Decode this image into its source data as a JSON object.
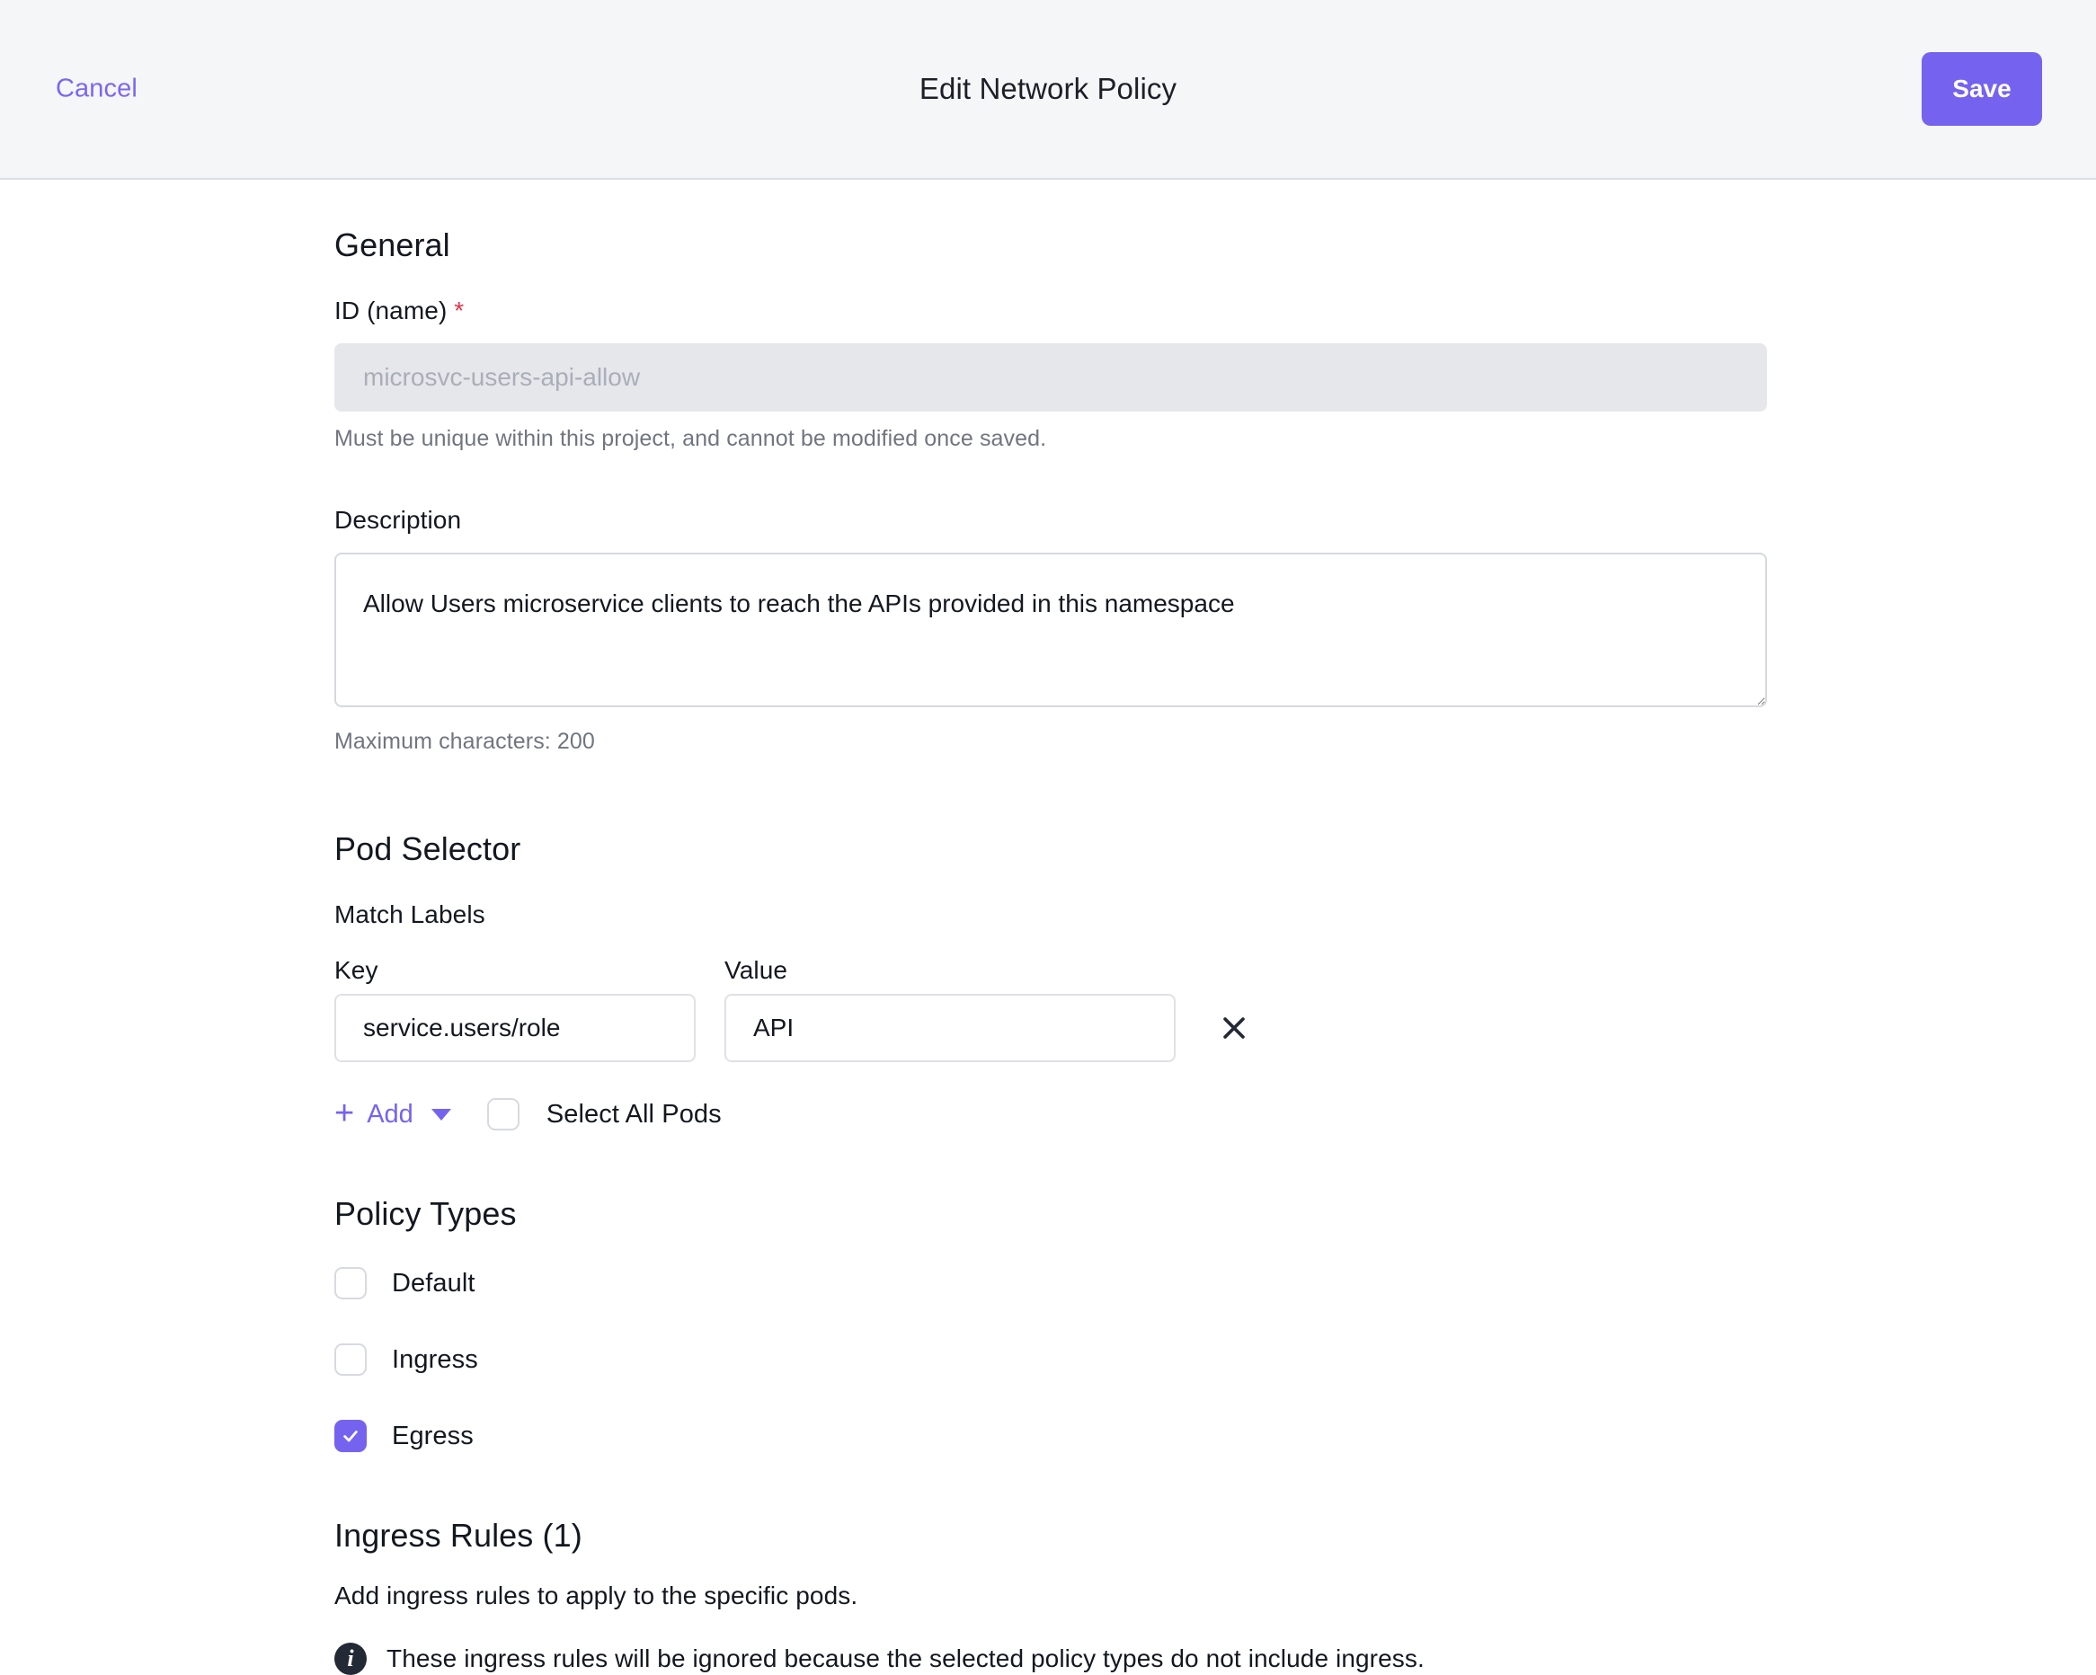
{
  "header": {
    "cancel_label": "Cancel",
    "title": "Edit Network Policy",
    "save_label": "Save",
    "accent_color": "#7563F0",
    "background_color": "#F5F6F8"
  },
  "general": {
    "section_title": "General",
    "id_label": "ID (name)",
    "id_required_mark": "*",
    "id_value": "microsvc-users-api-allow",
    "id_help": "Must be unique within this project, and cannot be modified once saved.",
    "description_label": "Description",
    "description_value": "Allow Users microservice clients to reach the APIs provided in this namespace",
    "description_help": "Maximum characters: 200"
  },
  "pod_selector": {
    "section_title": "Pod Selector",
    "match_labels_label": "Match Labels",
    "key_header": "Key",
    "value_header": "Value",
    "rows": [
      {
        "key": "service.users/role",
        "value": "API",
        "remove_icon": "close-icon"
      }
    ],
    "add_label": "Add",
    "add_icon": "plus-icon",
    "add_caret_icon": "chevron-down-icon",
    "select_all_label": "Select All Pods",
    "select_all_checked": false
  },
  "policy_types": {
    "section_title": "Policy Types",
    "options": [
      {
        "label": "Default",
        "checked": false
      },
      {
        "label": "Ingress",
        "checked": false
      },
      {
        "label": "Egress",
        "checked": true
      }
    ]
  },
  "ingress_rules": {
    "section_title": "Ingress Rules (1)",
    "description": "Add ingress rules to apply to the specific pods.",
    "notice_icon": "info-icon",
    "notice": "These ingress rules will be ignored because the selected policy types do not include ingress."
  }
}
